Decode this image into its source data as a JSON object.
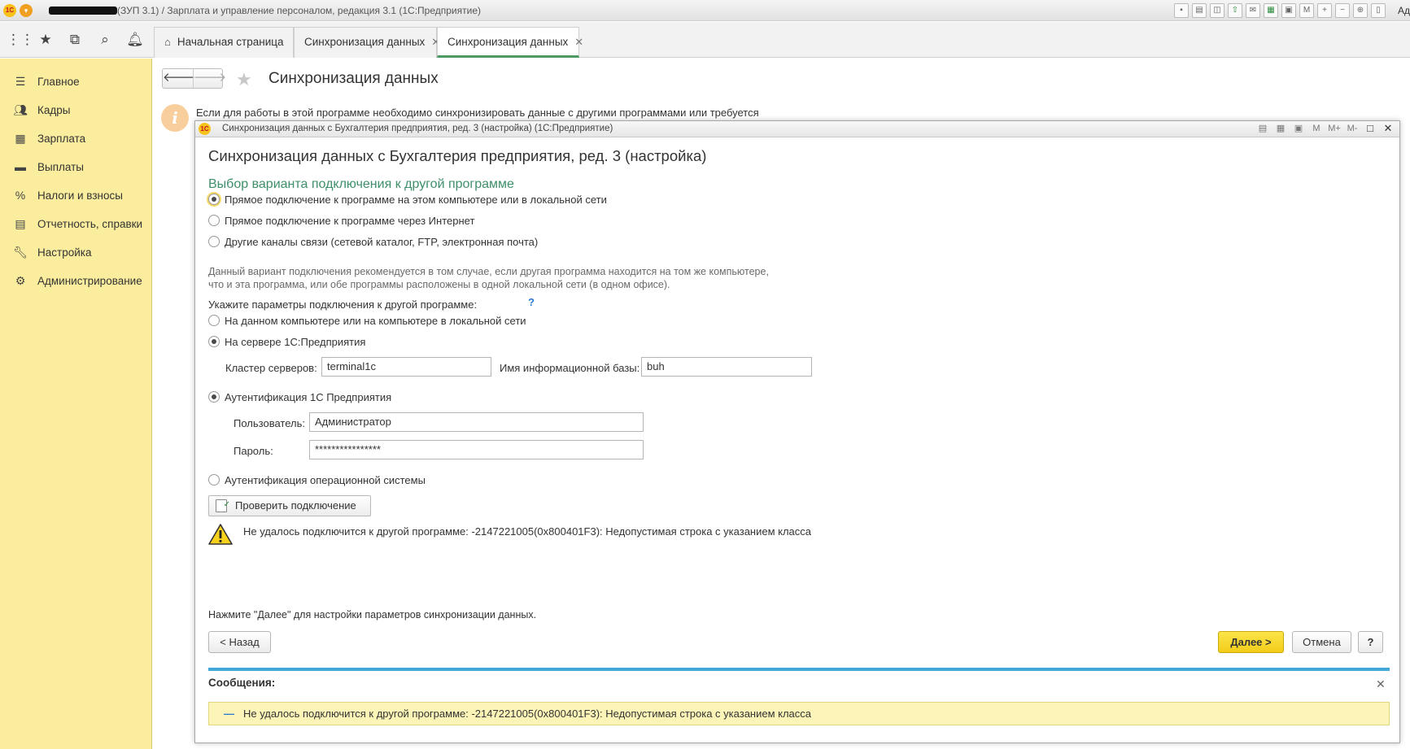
{
  "app": {
    "title": "(ЗУП 3.1) / Зарплата и управление персоналом, редакция 3.1  (1С:Предприятие)",
    "logo_text": "1С",
    "user_short": "Ад"
  },
  "top_panel": {
    "tabs": [
      {
        "label": "Начальная страница",
        "home": true
      },
      {
        "label": "Синхронизация данных",
        "closable": true
      },
      {
        "label": "Синхронизация данных",
        "closable": true,
        "active": true
      }
    ]
  },
  "sidebar": {
    "items": [
      {
        "label": "Главное",
        "icon": "menu-lines-icon"
      },
      {
        "label": "Кадры",
        "icon": "people-icon"
      },
      {
        "label": "Зарплата",
        "icon": "calculator-icon"
      },
      {
        "label": "Выплаты",
        "icon": "wallet-icon"
      },
      {
        "label": "Налоги и взносы",
        "icon": "percent-icon"
      },
      {
        "label": "Отчетность, справки",
        "icon": "report-icon"
      },
      {
        "label": "Настройка",
        "icon": "wrench-icon"
      },
      {
        "label": "Администрирование",
        "icon": "gear-icon"
      }
    ]
  },
  "page": {
    "title": "Синхронизация данных",
    "info_text": "Если для работы в этой программе необходимо синхронизировать данные с другими программами или требуется"
  },
  "modal": {
    "window_title": "Синхронизация данных с Бухгалтерия предприятия, ред. 3 (настройка)  (1С:Предприятие)",
    "heading": "Синхронизация данных с Бухгалтерия предприятия, ред. 3 (настройка)",
    "subheading": "Выбор варианта подключения к другой программе",
    "connection_options": [
      {
        "label": "Прямое подключение к программе на этом компьютере или в локальной сети",
        "selected": true
      },
      {
        "label": "Прямое подключение к программе через Интернет",
        "selected": false
      },
      {
        "label": "Другие каналы связи (сетевой каталог, FTP, электронная почта)",
        "selected": false
      }
    ],
    "description": "Данный вариант подключения рекомендуется в том случае, если другая программа находится на том же компьютере, что и эта программа, или обе программы расположены в одной локальной сети (в одном офисе).",
    "params_label": "Укажите параметры подключения к другой программе:",
    "help_mark": "?",
    "location_options": [
      {
        "label": "На данном компьютере или на компьютере в локальной сети",
        "selected": false
      },
      {
        "label": "На сервере 1С:Предприятия",
        "selected": true
      }
    ],
    "cluster_label": "Кластер серверов:",
    "cluster_value": "terminal1c",
    "ib_label": "Имя информационной базы:",
    "ib_value": "buh",
    "auth_1c_label": "Аутентификация 1С Предприятия",
    "user_label": "Пользователь:",
    "user_value": "Администратор",
    "password_label": "Пароль:",
    "password_value": "****************",
    "auth_os_label": "Аутентификация операционной системы",
    "check_button": "Проверить подключение",
    "warning_text": "Не удалось подключится к другой программе: -2147221005(0x800401F3): Недопустимая строка с указанием класса",
    "next_hint": "Нажмите \"Далее\" для настройки параметров синхронизации данных.",
    "back_button": "< Назад",
    "next_button": "Далее >",
    "cancel_button": "Отмена",
    "help_button": "?",
    "messages_title": "Сообщения:",
    "messages": [
      "Не удалось подключится к другой программе: -2147221005(0x800401F3): Недопустимая строка с указанием класса"
    ]
  },
  "colors": {
    "sidebar_bg": "#fbed9e",
    "accent_green": "#4d9a62",
    "subheading_green": "#3f8f6a",
    "primary_button": "#f2cc1a",
    "messages_bar": "#42a8d8",
    "message_bg": "#fdf5b8"
  }
}
